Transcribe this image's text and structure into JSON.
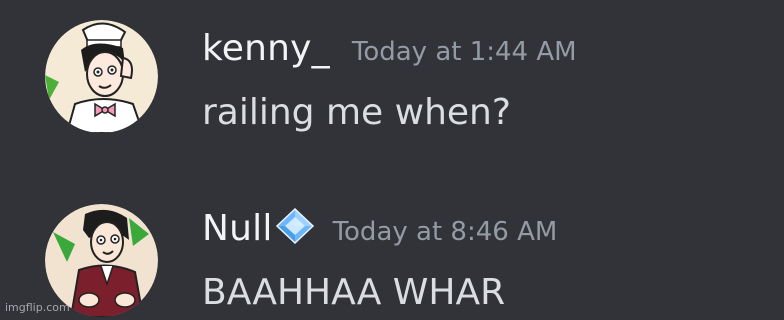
{
  "messages": [
    {
      "username": "kenny_",
      "timestamp": "Today at 1:44 AM",
      "content": "railing me when?",
      "avatar": "character-avatar-kenny"
    },
    {
      "username": "Null",
      "badge": "diamond-badge-icon",
      "timestamp": "Today at 8:46 AM",
      "content": "BAAHHAA WHAR",
      "avatar": "character-avatar-null"
    }
  ],
  "watermark": "imgflip.com",
  "colors": {
    "background": "#313338",
    "username": "#f2f3f5",
    "timestamp": "#949ba4",
    "message_text": "#dbdee1",
    "badge": "#8ec5ff"
  }
}
